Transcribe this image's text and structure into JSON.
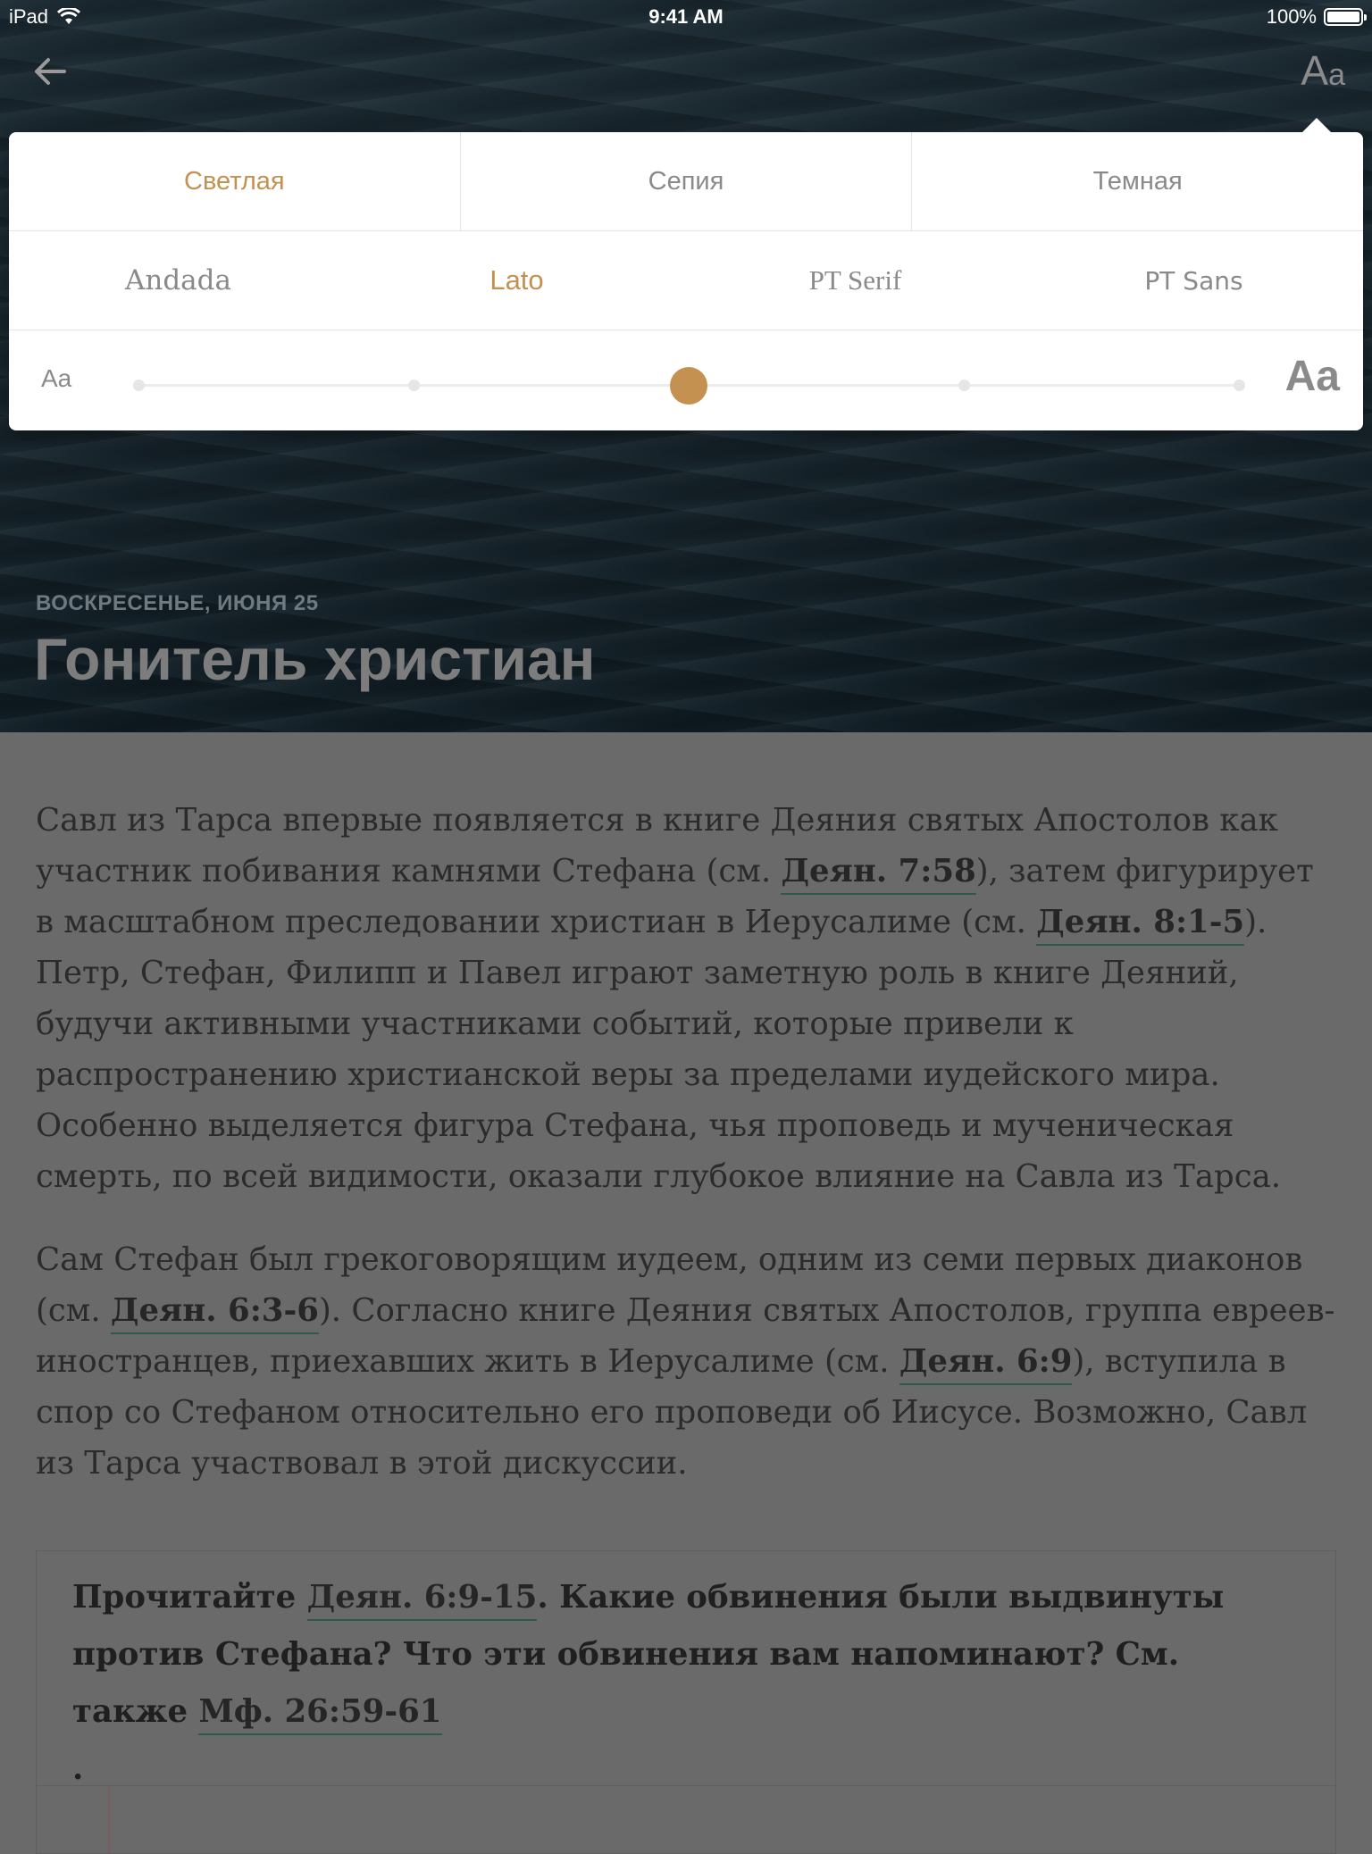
{
  "status_bar": {
    "device": "iPad",
    "time": "9:41 AM",
    "battery": "100%"
  },
  "header": {
    "back_icon": "arrow-left-icon",
    "font_settings_big": "A",
    "font_settings_small": "a"
  },
  "settings": {
    "themes": [
      {
        "label": "Светлая",
        "active": true
      },
      {
        "label": "Сепия",
        "active": false
      },
      {
        "label": "Темная",
        "active": false
      }
    ],
    "fonts": [
      {
        "label": "Andada",
        "active": false
      },
      {
        "label": "Lato",
        "active": true
      },
      {
        "label": "PT Serif",
        "active": false
      },
      {
        "label": "PT Sans",
        "active": false
      }
    ],
    "size_small_label": "Aa",
    "size_large_label": "Aa",
    "size_steps": 5,
    "size_selected_index": 2,
    "accent_color": "#c49150"
  },
  "hero": {
    "date": "ВОСКРЕСЕНЬЕ, ИЮНЯ 25",
    "title": "Гонитель христиан"
  },
  "article": {
    "p1": {
      "t1": "Савл из Тарса впервые появляется в книге Деяния святых Апостолов как участник побивания камнями Стефана (см. ",
      "ref1": "Деян. 7:58",
      "t2": "), затем фигурирует в масштабном преследовании христиан в Иерусалиме (см. ",
      "ref2": "Деян. 8:1-5",
      "t3": "). Петр, Стефан, Филипп и Павел играют заметную роль в книге Деяний, будучи активными участниками событий, которые привели к распространению христианской веры за пределами иудейского мира. Особенно выделяется фигура Стефана, чья проповедь и мученическая смерть, по всей видимости, оказали глубокое влияние на Савла из Тарса."
    },
    "p2": {
      "t1": "Сам Стефан был грекоговорящим иудеем, одним из семи первых диаконов (см. ",
      "ref1": "Деян. 6:3-6",
      "t2": "). Согласно книге Деяния святых Апостолов, группа евреев-иностранцев, приехавших жить в Иерусалиме (см. ",
      "ref2": "Деян. 6:9",
      "t3": "), вступила в спор со Стефаном относительно его проповеди об Иисусе. Возможно, Савл из Тарса участвовал в этой дискуссии."
    },
    "question": {
      "t1": "Прочитайте ",
      "ref1": "Деян. 6:9-15",
      "t2": ". Какие обвинения были выдвинуты против Стефана? Что эти обвинения вам напоминают? См. также ",
      "ref2": "Мф. 26:59-61",
      "t3": "."
    }
  }
}
